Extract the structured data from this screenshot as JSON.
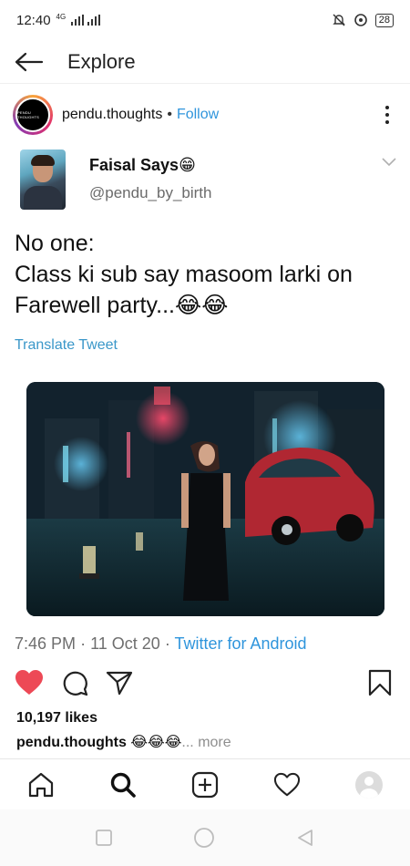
{
  "status_bar": {
    "time": "12:40",
    "network": "4G",
    "battery": "28"
  },
  "header": {
    "title": "Explore"
  },
  "post": {
    "username": "pendu.thoughts",
    "separator": "•",
    "follow_label": "Follow",
    "avatar_text": "PENDU THOUGHTS",
    "likes": "10,197 likes",
    "caption_user": "pendu.thoughts",
    "caption_emoji": "😂😂😂",
    "caption_more": "... more"
  },
  "tweet": {
    "name": "Faisal Says😁",
    "handle": "@pendu_by_birth",
    "text_line1": "No one:",
    "text_line2": "Class ki sub say masoom larki on",
    "text_line3": "Farewell party...😂😂",
    "translate_label": "Translate Tweet",
    "time": "7:46 PM",
    "date": "11 Oct 20",
    "client": "Twitter for Android",
    "meta_sep": "·"
  },
  "colors": {
    "like_red": "#ed4956",
    "link_blue": "#2f95dc",
    "translate_blue": "#3a97c9"
  },
  "icons": {
    "back": "arrow-left-icon",
    "more": "more-vertical-icon",
    "chevron": "chevron-down-icon",
    "like": "heart-icon",
    "comment": "comment-icon",
    "share": "send-icon",
    "save": "bookmark-icon",
    "home": "home-icon",
    "search": "search-icon",
    "create": "plus-square-icon",
    "activity": "heart-outline-icon",
    "profile": "profile-avatar"
  }
}
